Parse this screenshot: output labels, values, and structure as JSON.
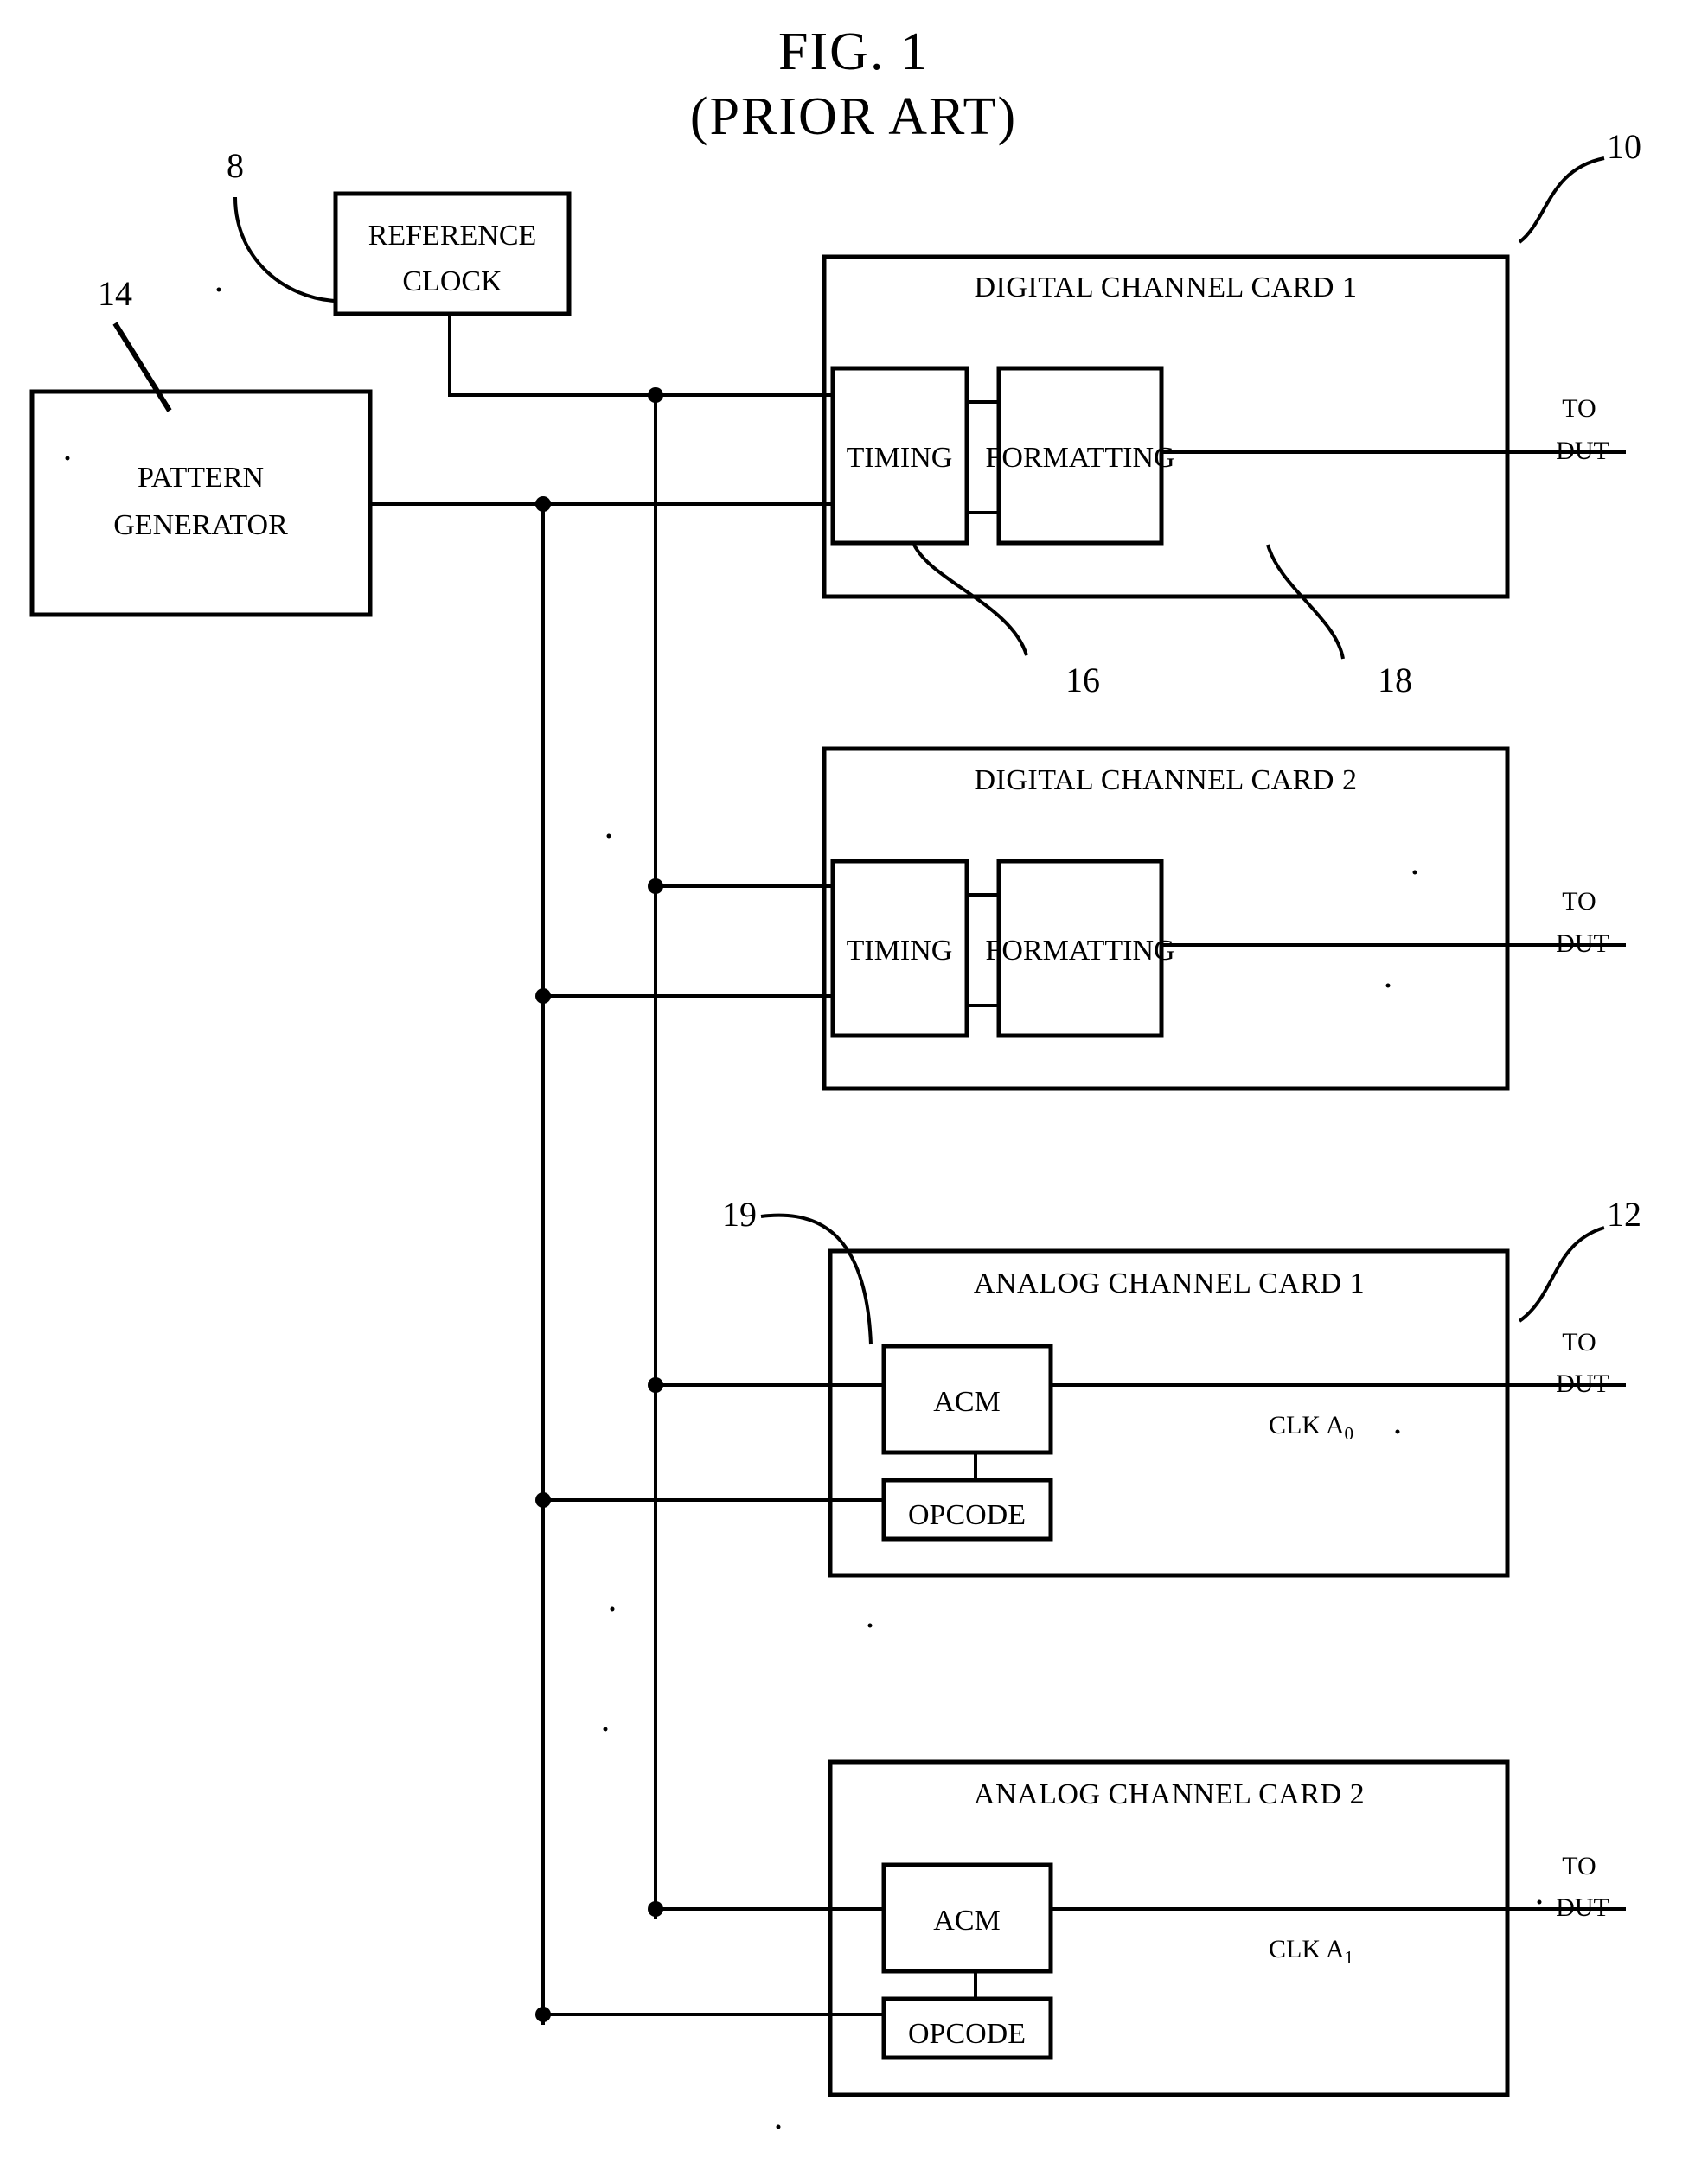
{
  "figure": {
    "title": "FIG.  1",
    "subtitle": "(PRIOR ART)"
  },
  "blocks": {
    "reference_clock": {
      "line1": "REFERENCE",
      "line2": "CLOCK"
    },
    "pattern_generator": {
      "line1": "PATTERN",
      "line2": "GENERATOR"
    },
    "digital_card_1": {
      "title": "DIGITAL CHANNEL CARD 1",
      "timing": "TIMING",
      "formatting": "FORMATTING",
      "output": {
        "line1": "TO",
        "line2": "DUT"
      }
    },
    "digital_card_2": {
      "title": "DIGITAL CHANNEL CARD 2",
      "timing": "TIMING",
      "formatting": "FORMATTING",
      "output": {
        "line1": "TO",
        "line2": "DUT"
      }
    },
    "analog_card_1": {
      "title": "ANALOG CHANNEL CARD 1",
      "acm": "ACM",
      "opcode": "OPCODE",
      "clk_label": "CLK A",
      "clk_sub": "0",
      "output": {
        "line1": "TO",
        "line2": "DUT"
      }
    },
    "analog_card_2": {
      "title": "ANALOG CHANNEL CARD 2",
      "acm": "ACM",
      "opcode": "OPCODE",
      "clk_label": "CLK A",
      "clk_sub": "1",
      "output": {
        "line1": "TO",
        "line2": "DUT"
      }
    }
  },
  "reference_numerals": {
    "n8": "8",
    "n14": "14",
    "n10": "10",
    "n16": "16",
    "n18": "18",
    "n19": "19",
    "n12": "12"
  },
  "colors": {
    "ink": "#000000",
    "paper": "#ffffff"
  }
}
